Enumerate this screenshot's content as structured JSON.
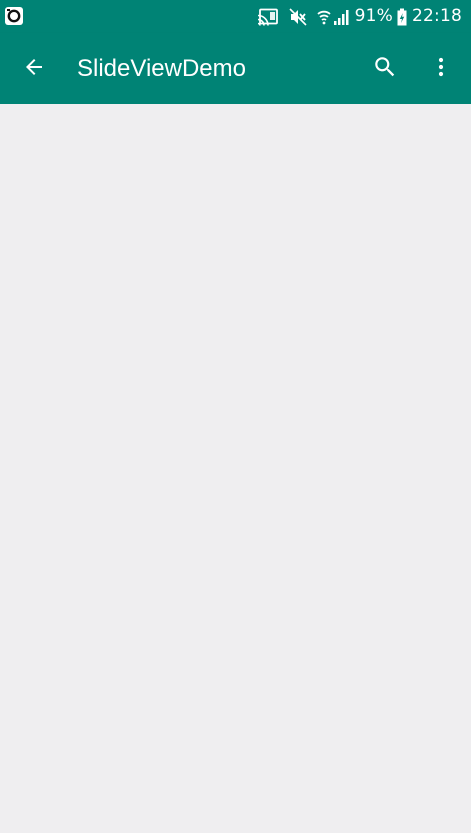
{
  "status_bar": {
    "battery_percent": "91%",
    "time": "22:18",
    "icons": [
      "notification-app-icon",
      "cast-icon",
      "mute-icon",
      "wifi-icon",
      "signal-icon",
      "battery-charging-icon"
    ]
  },
  "toolbar": {
    "title": "SlideViewDemo",
    "icons": [
      "back-arrow-icon",
      "search-icon",
      "more-vert-icon"
    ]
  },
  "colors": {
    "primary": "#008375",
    "background": "#efeef0",
    "on_primary": "#ffffff"
  }
}
